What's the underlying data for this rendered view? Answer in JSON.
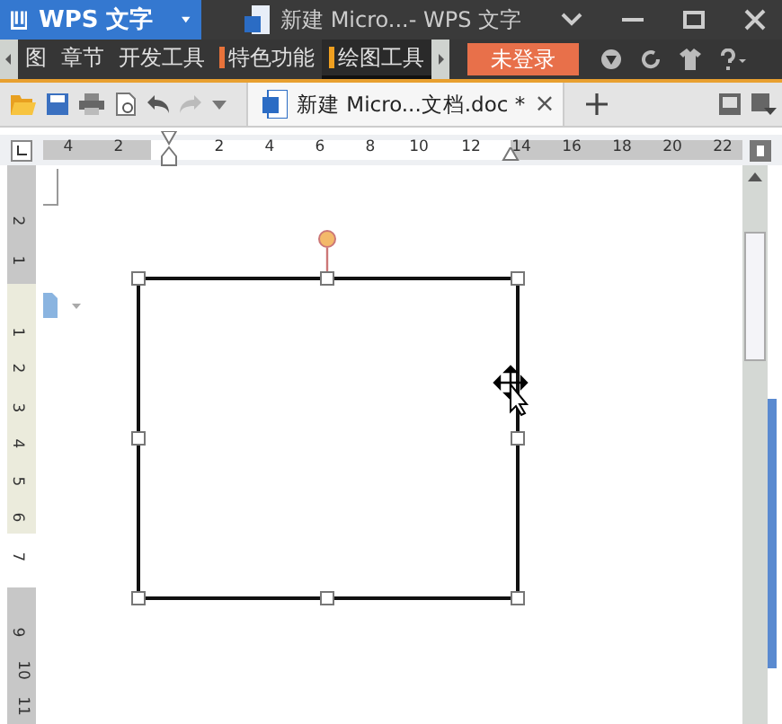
{
  "app_menu": {
    "label": "WPS 文字"
  },
  "window": {
    "title": "新建 Micro...- WPS 文字"
  },
  "menu": [
    {
      "label": "图",
      "selected": false
    },
    {
      "label": "章节",
      "selected": false
    },
    {
      "label": "开发工具",
      "selected": false
    },
    {
      "label": "特色功能",
      "selected": false,
      "color": "#e8723a"
    },
    {
      "label": "绘图工具",
      "selected": true,
      "color": "#f0a020"
    }
  ],
  "login_button": {
    "label": "未登录"
  },
  "document_tab": {
    "title": "新建 Micro...文档.doc *",
    "close": "×"
  },
  "ruler": {
    "horizontal": [
      "4",
      "2",
      "2",
      "4",
      "6",
      "8",
      "10",
      "12",
      "14",
      "16",
      "18",
      "20",
      "22"
    ],
    "vertical": [
      "2",
      "1",
      "1",
      "2",
      "3",
      "4",
      "5",
      "6",
      "7",
      "9",
      "10",
      "11"
    ]
  }
}
